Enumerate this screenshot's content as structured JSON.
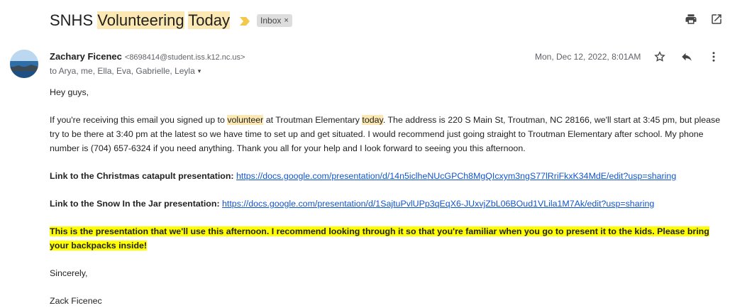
{
  "subject": {
    "prefix": "SNHS ",
    "hl1": "Volunteering",
    "space": " ",
    "hl2": "Today"
  },
  "label": {
    "text": "Inbox",
    "close": "×"
  },
  "icons": {
    "print": "print-icon",
    "popout": "open-in-new-window-icon",
    "star": "star-icon",
    "reply": "reply-icon",
    "more": "more-vertical-icon",
    "important": "important-marker-icon",
    "avatar": "avatar-lake-photo",
    "expand": "chevron-down-icon"
  },
  "colors": {
    "highlight_yellow": "#fce8b2",
    "highlight_bright": "#ffff00",
    "link": "#1155cc",
    "important": "#f2c94c"
  },
  "sender": {
    "name": "Zachary Ficenec",
    "email": "<8698414@student.iss.k12.nc.us>"
  },
  "recipients": {
    "text": "to Arya, me, Ella, Eva, Gabrielle, Leyla",
    "caret": "▾"
  },
  "date": "Mon, Dec 12, 2022, 8:01AM",
  "body": {
    "greeting": "Hey guys,",
    "p1_a": "If you're receiving this email you signed up to ",
    "p1_hl1": "volunteer",
    "p1_b": " at Troutman Elementary ",
    "p1_hl2": "today",
    "p1_c": ". The address is 220 S Main St, Troutman, NC 28166, we'll start at 3:45 pm, but please try to be there at 3:40 pm at the latest so we have time to set up and get situated. I would recommend just going straight to Troutman Elementary after school. My phone number is (704) 657-6324 if you need anything. Thank you all for your help and I look forward to seeing you this afternoon.",
    "link1_label": "Link to the Christmas catapult presentation:",
    "link1_url": "https://docs.google.com/presentation/d/14n5iclheNUcGPCh8MgQIcxym3ngS77lRriFkxK34MdE/edit?usp=sharing",
    "link2_label": "Link to the Snow In the Jar presentation:",
    "link2_url": "https://docs.google.com/presentation/d/1SajtuPvlUPp3qEqX6-JUxvjZbL06BOud1VLila1M7Ak/edit?usp=sharing",
    "highlight_para": "This is the presentation that we'll use this afternoon. I recommend looking through it so that you're familiar when you go to present it to the kids. Please bring your backpacks inside!",
    "closing": "Sincerely,",
    "signature": "Zack Ficenec"
  }
}
